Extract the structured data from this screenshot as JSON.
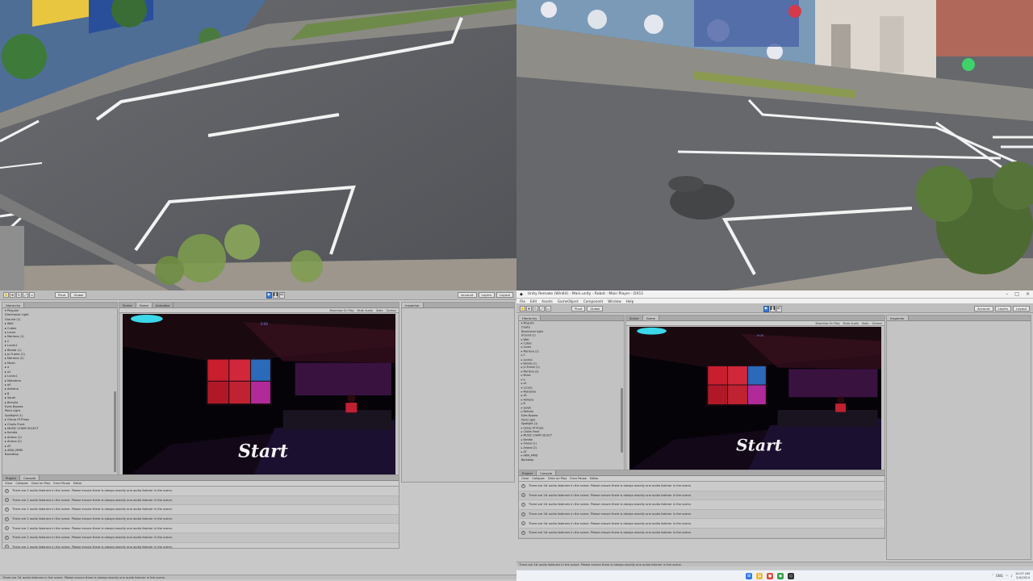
{
  "cameras": {
    "top_left": {
      "description_label": ""
    },
    "top_right": {
      "description_label": ""
    }
  },
  "editor_left": {
    "toolbar": {
      "pivot_label": "Pivot",
      "global_label": "Global",
      "account_label": "Account",
      "layers_label": "Layers",
      "layout_label": "Layout"
    },
    "tabs": {
      "hierarchy": "Hierarchy",
      "scene": "Scene",
      "game": "Game",
      "animator": "Animator",
      "inspector": "Inspector",
      "project": "Project",
      "console": "Console"
    },
    "hierarchy_items": [
      "▾ Pinguim",
      "  Directional Light",
      "  Ground (1)",
      "▸ Wall",
      "▸ Cubes",
      "▸ Lucas",
      "▸ Mariana (1)",
      "▸ C",
      "▸ Lucas1",
      "▸ Banda (1)",
      "▸ Ju Frame (1)",
      "▸ Mariana (2)",
      "▸ Music",
      "  ▸ a",
      "  ▸ a1",
      "▸ Lucas1",
      "▸ Mahatma",
      "  ▸ a5",
      "▸ Adriana",
      "▸ B",
      "▸ Sarah",
      "▸ Behulia",
      "  Eyes Bypass",
      "  Point Light",
      "  Spotlight (1)",
      "▸ Group Of Props",
      "▸ Chairs Front",
      "▸ MUSIC CHAIR SELECT",
      "▸ Kandia",
      "▸ Ariana (1)",
      "▸ Ariana (2)",
      "▸ AT",
      "▸ ARIA_MMD",
      "  Backdrop"
    ],
    "game_bar": {
      "maximize_label": "Maximize On Play",
      "mute_label": "Mute Audio",
      "stats_label": "Stats",
      "gizmos_label": "Gizmos"
    },
    "game": {
      "start_text": "Start",
      "timer_text": "0:00"
    },
    "console_toolbar": {
      "clear_label": "Clear",
      "collapse_label": "Collapse",
      "clear_on_play_label": "Clear on Play",
      "error_pause_label": "Error Pause",
      "editor_label": "Editor"
    },
    "logs": [
      "There are 2 audio listeners in the scene. Please ensure there is always exactly one audio listener in the scene.",
      "There are 2 audio listeners in the scene. Please ensure there is always exactly one audio listener in the scene.",
      "There are 2 audio listeners in the scene. Please ensure there is always exactly one audio listener in the scene.",
      "There are 2 audio listeners in the scene. Please ensure there is always exactly one audio listener in the scene.",
      "There are 2 audio listeners in the scene. Please ensure there is always exactly one audio listener in the scene.",
      "There are 2 audio listeners in the scene. Please ensure there is always exactly one audio listener in the scene.",
      "There are 2 audio listeners in the scene. Please ensure there is always exactly one audio listener in the scene."
    ],
    "status_text": "There are 2# audio listeners in the scene. Please ensure there is always exactly one audio listener in the scene."
  },
  "editor_right": {
    "window_title": "Unity Remake (Win64) - Main.unity - Robot - Main Player - DX11",
    "menu": [
      "File",
      "Edit",
      "Assets",
      "GameObject",
      "Component",
      "Window",
      "Help"
    ],
    "toolbar": {
      "pivot_label": "Pivot",
      "global_label": "Global",
      "account_label": "Account",
      "layers_label": "Layers",
      "layout_label": "Layout"
    },
    "tabs": {
      "hierarchy": "Hierarchy",
      "scene": "Scene",
      "game": "Game",
      "inspector": "Inspector",
      "project": "Project",
      "console": "Console"
    },
    "hierarchy_items": [
      "▾ Pinguim",
      "  Create",
      "  Directional Light",
      "  Ground (1)",
      "▸ Wall",
      "▸ Cubes",
      "▸ Lucas",
      "▸ Mariana (1)",
      "▸ C",
      "▸ Lucas1",
      "▸ Banda (1)",
      "▸ Ju Frame (1)",
      "▸ Mariana (2)",
      "▸ Music",
      "  ▸ a",
      "  ▸ a1",
      "▸ Lucas1",
      "▸ Mahatma",
      "  ▸ a5",
      "▸ Adriana",
      "▸ B",
      "▸ Sarah",
      "▸ Behulia",
      "  Eyes Bypass",
      "  Point Light",
      "  Spotlight (1)",
      "▸ Group Of Props",
      "▸ Chairs Front",
      "▸ MUSIC CHAIR SELECT",
      "▸ Kandia",
      "▸ Ariana (1)",
      "▸ Ariana (2)",
      "▸ AT",
      "▸ ARIA_MMD",
      "  Backdrop"
    ],
    "game_bar": {
      "maximize_label": "Maximize On Play",
      "mute_label": "Mute Audio",
      "stats_label": "Stats",
      "gizmos_label": "Gizmos"
    },
    "game": {
      "start_text": "Start",
      "timer_text": "0:00"
    },
    "console_toolbar": {
      "clear_label": "Clear",
      "collapse_label": "Collapse",
      "clear_on_play_label": "Clear on Play",
      "error_pause_label": "Error Pause",
      "editor_label": "Editor"
    },
    "logs": [
      "There are 2# audio listeners in the scene. Please ensure there is always exactly one audio listener in the scene.",
      "There are 2# audio listeners in the scene. Please ensure there is always exactly one audio listener in the scene.",
      "There are 2# audio listeners in the scene. Please ensure there is always exactly one audio listener in the scene.",
      "There are 2# audio listeners in the scene. Please ensure there is always exactly one audio listener in the scene.",
      "There are 2# audio listeners in the scene. Please ensure there is always exactly one audio listener in the scene.",
      "There are 2# audio listeners in the scene. Please ensure there is always exactly one audio listener in the scene."
    ],
    "status_text": "There are 2# audio listeners in the scene. Please ensure there is always exactly one audio listener in the scene.",
    "taskbar": {
      "time": "10:07 AM",
      "date": "2/4/2024",
      "tray_lang": "ENG"
    }
  }
}
